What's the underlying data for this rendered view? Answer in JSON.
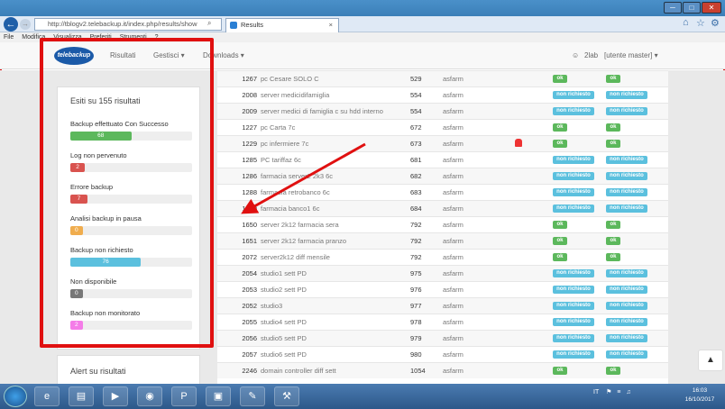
{
  "browser": {
    "address": "http://tblogv2.telebackup.it/index.php/results/show",
    "search_icon": "search-icon",
    "tab_title": "Results",
    "tab_close": "×",
    "title_buttons": [
      "─",
      "□",
      "✕"
    ],
    "toolbar_icons": [
      "home-icon",
      "star-icon",
      "gear-icon"
    ]
  },
  "menubar": [
    "File",
    "Modifica",
    "Visualizza",
    "Preferiti",
    "Strumenti",
    "?"
  ],
  "nav": {
    "logo": "telebackup",
    "results": "Risultati",
    "manage": "Gestisci ▾",
    "downloads": "Downloads ▾",
    "user": "2lab",
    "role": "[utente master] ▾"
  },
  "summary": {
    "title": "Esiti su 155 risultati",
    "stats": [
      {
        "label": "Backup effettuato Con Successo",
        "value": "68",
        "pct": 0.5,
        "color": "#5cb85c"
      },
      {
        "label": "Log non pervenuto",
        "value": "2",
        "pct": 0.12,
        "color": "#d9534f"
      },
      {
        "label": "Errore backup",
        "value": "7",
        "pct": 0.14,
        "color": "#d9534f"
      },
      {
        "label": "Analisi backup in pausa",
        "value": "0",
        "pct": 0.1,
        "color": "#f0ad4e"
      },
      {
        "label": "Backup non richiesto",
        "value": "76",
        "pct": 0.58,
        "color": "#5bc0de"
      },
      {
        "label": "Non disponibile",
        "value": "0",
        "pct": 0.1,
        "color": "#777777"
      },
      {
        "label": "Backup non monitorato",
        "value": "2",
        "pct": 0.1,
        "color": "#f47ce8"
      }
    ],
    "alert_title": "Alert su risultati"
  },
  "rows": [
    {
      "id": "1267",
      "name": "pc Cesare SOLO C",
      "num": "529",
      "user": "asfarm",
      "b1": "ok",
      "b2": "ok",
      "alarm": false
    },
    {
      "id": "2008",
      "name": "server medicidifamiglia",
      "num": "554",
      "user": "asfarm",
      "b1": "non richiesto",
      "b2": "non richiesto",
      "alarm": false
    },
    {
      "id": "2009",
      "name": "server medici di famiglia c su hdd interno",
      "num": "554",
      "user": "asfarm",
      "b1": "non richiesto",
      "b2": "non richiesto",
      "alarm": false
    },
    {
      "id": "1227",
      "name": "pc Carta 7c",
      "num": "672",
      "user": "asfarm",
      "b1": "ok",
      "b2": "ok",
      "alarm": false
    },
    {
      "id": "1229",
      "name": "pc infermiere 7c",
      "num": "673",
      "user": "asfarm",
      "b1": "ok",
      "b2": "ok",
      "alarm": true
    },
    {
      "id": "1285",
      "name": "PC tariffaz 6c",
      "num": "681",
      "user": "asfarm",
      "b1": "non richiesto",
      "b2": "non richiesto",
      "alarm": false
    },
    {
      "id": "1286",
      "name": "farmacia server2 2k3 6c",
      "num": "682",
      "user": "asfarm",
      "b1": "non richiesto",
      "b2": "non richiesto",
      "alarm": false
    },
    {
      "id": "1288",
      "name": "farmacia retrobanco 6c",
      "num": "683",
      "user": "asfarm",
      "b1": "non richiesto",
      "b2": "non richiesto",
      "alarm": false
    },
    {
      "id": "1289",
      "name": "farmacia banco1 6c",
      "num": "684",
      "user": "asfarm",
      "b1": "non richiesto",
      "b2": "non richiesto",
      "alarm": false
    },
    {
      "id": "1650",
      "name": "server 2k12 farmacia sera",
      "num": "792",
      "user": "asfarm",
      "b1": "ok",
      "b2": "ok",
      "alarm": false
    },
    {
      "id": "1651",
      "name": "server 2k12 farmacia pranzo",
      "num": "792",
      "user": "asfarm",
      "b1": "ok",
      "b2": "ok",
      "alarm": false
    },
    {
      "id": "2072",
      "name": "server2k12 diff mensile",
      "num": "792",
      "user": "asfarm",
      "b1": "ok",
      "b2": "ok",
      "alarm": false
    },
    {
      "id": "2054",
      "name": "studio1 sett PD",
      "num": "975",
      "user": "asfarm",
      "b1": "non richiesto",
      "b2": "non richiesto",
      "alarm": false
    },
    {
      "id": "2053",
      "name": "studio2 sett PD",
      "num": "976",
      "user": "asfarm",
      "b1": "non richiesto",
      "b2": "non richiesto",
      "alarm": false
    },
    {
      "id": "2052",
      "name": "studio3",
      "num": "977",
      "user": "asfarm",
      "b1": "non richiesto",
      "b2": "non richiesto",
      "alarm": false
    },
    {
      "id": "2055",
      "name": "studio4 sett PD",
      "num": "978",
      "user": "asfarm",
      "b1": "non richiesto",
      "b2": "non richiesto",
      "alarm": false
    },
    {
      "id": "2056",
      "name": "studio5 sett PD",
      "num": "979",
      "user": "asfarm",
      "b1": "non richiesto",
      "b2": "non richiesto",
      "alarm": false
    },
    {
      "id": "2057",
      "name": "studio6 sett PD",
      "num": "980",
      "user": "asfarm",
      "b1": "non richiesto",
      "b2": "non richiesto",
      "alarm": false
    },
    {
      "id": "2246",
      "name": "domain controller diff sett",
      "num": "1054",
      "user": "asfarm",
      "b1": "ok",
      "b2": "ok",
      "alarm": false
    }
  ],
  "badge_colors": {
    "ok": "#5cb85c",
    "non richiesto": "#5bc0de"
  },
  "scroll_top": "▲",
  "taskbar": {
    "icons": [
      "windows-start-icon",
      "ie-icon",
      "folder-icon",
      "media-player-icon",
      "chrome-icon",
      "powerpoint-icon",
      "app-icon",
      "paint-icon",
      "tools-icon"
    ],
    "lang": "IT",
    "time": "16:03",
    "date": "16/10/2017"
  }
}
